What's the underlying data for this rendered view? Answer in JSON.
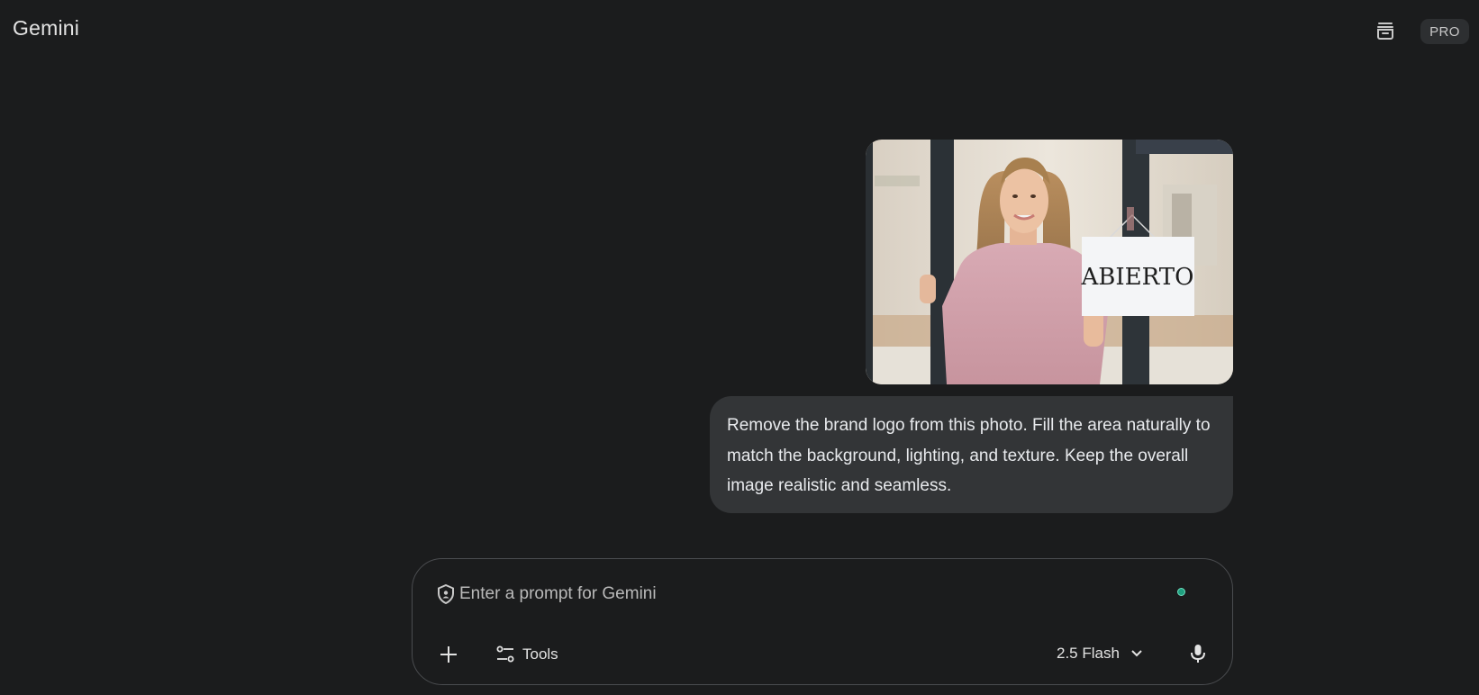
{
  "app": {
    "title": "Gemini"
  },
  "header": {
    "history_icon": "chat-history-icon",
    "badge": "PRO"
  },
  "conversation": {
    "user_image": {
      "sign_text": "ABIERTO",
      "alt": "Woman holding door with ABIERTO sign"
    },
    "user_message": "Remove the brand logo from this photo. Fill the area naturally to match the background, lighting, and texture. Keep the overall image realistic and seamless."
  },
  "composer": {
    "placeholder": "Enter a prompt for Gemini",
    "value": "",
    "tools_label": "Tools",
    "model_label": "2.5 Flash",
    "status_dot_color": "#1f9f7f"
  },
  "colors": {
    "background": "#1b1c1d",
    "bubble": "#333537",
    "border": "#4a4c4f"
  }
}
